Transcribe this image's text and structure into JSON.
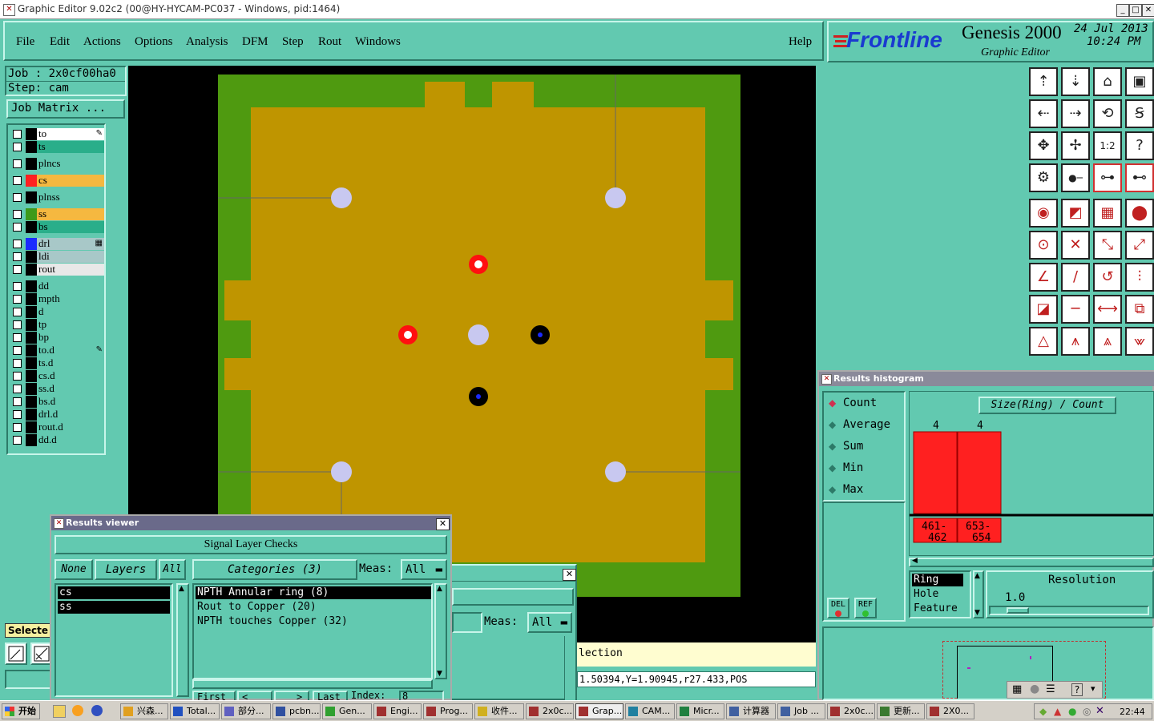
{
  "window": {
    "title": "Graphic Editor 9.02c2 (00@HY-HYCAM-PC037 - Windows, pid:1464)"
  },
  "menu": {
    "items": [
      "File",
      "Edit",
      "Actions",
      "Options",
      "Analysis",
      "DFM",
      "Step",
      "Rout",
      "Windows"
    ],
    "help": "Help"
  },
  "brand": {
    "logo": "Frontline",
    "product": "Genesis 2000",
    "subtitle": "Graphic Editor",
    "date": "24 Jul 2013",
    "time": "10:24 PM"
  },
  "job": {
    "job_line": "Job : 2x0cf00ha0",
    "step_line": "Step: cam",
    "matrix_button": "Job Matrix ..."
  },
  "layers": [
    {
      "name": "to",
      "color": "#ffffff",
      "bg": "#ffffff",
      "mark": "pen"
    },
    {
      "name": "ts",
      "color": "#000000",
      "bg": "#2aae8a",
      "mark": ""
    },
    {
      "name": "plncs",
      "color": "#000000",
      "bg": "#62c9b0",
      "mark": ""
    },
    {
      "name": "cs",
      "color": "#ff2020",
      "bg": "#f5b840",
      "mark": ""
    },
    {
      "name": "plnss",
      "color": "#000000",
      "bg": "#62c9b0",
      "mark": ""
    },
    {
      "name": "ss",
      "color": "#3e9a1a",
      "bg": "#f5b840",
      "mark": ""
    },
    {
      "name": "bs",
      "color": "#000000",
      "bg": "#2aae8a",
      "mark": ""
    },
    {
      "name": "drl",
      "color": "#1a2aff",
      "bg": "#a8c8c8",
      "mark": "grid"
    },
    {
      "name": "ldi",
      "color": "#000000",
      "bg": "#a8c8c8",
      "mark": ""
    },
    {
      "name": "rout",
      "color": "#000000",
      "bg": "#e8e8e8",
      "mark": ""
    },
    {
      "name": "dd",
      "color": "#000000",
      "bg": "#62c9b0",
      "mark": ""
    },
    {
      "name": "mpth",
      "color": "#000000",
      "bg": "#62c9b0",
      "mark": ""
    },
    {
      "name": "d",
      "color": "#000000",
      "bg": "#62c9b0",
      "mark": ""
    },
    {
      "name": "tp",
      "color": "#000000",
      "bg": "#62c9b0",
      "mark": ""
    },
    {
      "name": "bp",
      "color": "#000000",
      "bg": "#62c9b0",
      "mark": ""
    },
    {
      "name": "to.d",
      "color": "#000000",
      "bg": "#62c9b0",
      "mark": "pen"
    },
    {
      "name": "ts.d",
      "color": "#000000",
      "bg": "#62c9b0",
      "mark": ""
    },
    {
      "name": "cs.d",
      "color": "#000000",
      "bg": "#62c9b0",
      "mark": ""
    },
    {
      "name": "ss.d",
      "color": "#000000",
      "bg": "#62c9b0",
      "mark": ""
    },
    {
      "name": "bs.d",
      "color": "#000000",
      "bg": "#62c9b0",
      "mark": ""
    },
    {
      "name": "drl.d",
      "color": "#000000",
      "bg": "#62c9b0",
      "mark": ""
    },
    {
      "name": "rout.d",
      "color": "#000000",
      "bg": "#62c9b0",
      "mark": ""
    },
    {
      "name": "dd.d",
      "color": "#000000",
      "bg": "#62c9b0",
      "mark": ""
    }
  ],
  "selected_label": "Selecte",
  "results_viewer": {
    "title": "Results viewer",
    "header": "Signal Layer Checks",
    "none_btn": "None",
    "layers_btn": "Layers",
    "all_btn": "All",
    "categories_btn": "Categories (3)",
    "meas_label": "Meas:",
    "meas_value": "All",
    "layer_list": [
      "cs",
      "ss"
    ],
    "categories": [
      "NPTH Annular ring (8)",
      "Rout to Copper (20)",
      "NPTH touches Copper (32)"
    ],
    "first_btn": "First",
    "prev_btn": "<",
    "next_btn": ">",
    "last_btn": "Last",
    "index_label": "Index:",
    "index_value": "8"
  },
  "back_window": {
    "meas_label": "Meas:",
    "meas_value": "All",
    "selection_text": "lection"
  },
  "status": {
    "coords": "1.50394,Y=1.90945,r27.433,POS"
  },
  "histogram": {
    "title": "Results histogram",
    "modes": [
      "Count",
      "Average",
      "Sum",
      "Min",
      "Max"
    ],
    "selected_mode": "Count",
    "chart_title": "Size(Ring) / Count",
    "bars": [
      {
        "label": "461-462",
        "count": 4
      },
      {
        "label": "653-654",
        "count": 4
      }
    ],
    "del_label": "DEL",
    "ref_label": "REF",
    "fields": [
      "Ring",
      "Hole",
      "Feature"
    ],
    "selected_field": "Ring",
    "resolution_label": "Resolution",
    "resolution_value": "1.0"
  },
  "taskbar": {
    "start": "开始",
    "tasks": [
      "兴森...",
      "Total...",
      "部分...",
      "pcbn...",
      "Gen...",
      "Engi...",
      "Prog...",
      "收件...",
      "2x0c...",
      "Grap...",
      "CAM...",
      "Micr...",
      "计算器",
      "Job ...",
      "2x0c...",
      "更新...",
      "2X0..."
    ],
    "clock": "22:44"
  }
}
